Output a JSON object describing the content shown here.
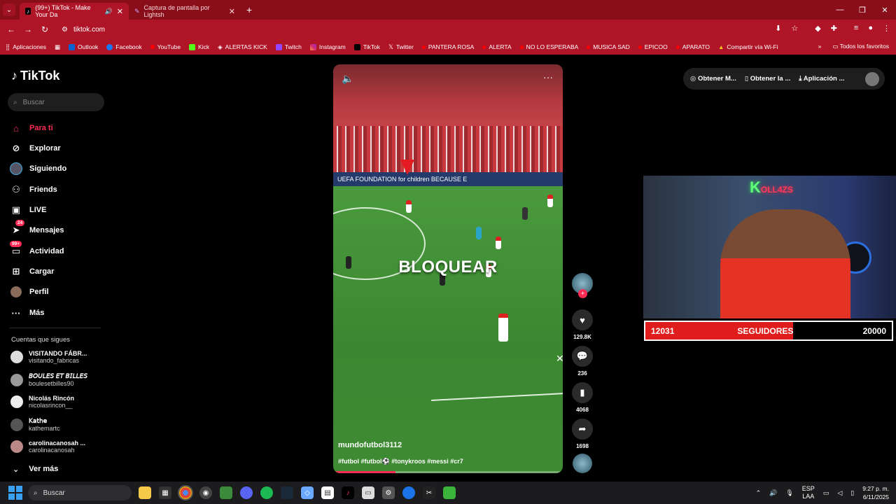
{
  "browser": {
    "tabs": [
      {
        "title": "(99+) TikTok - Make Your Da",
        "active": true
      },
      {
        "title": "Captura de pantalla por Lightsh",
        "active": false
      }
    ],
    "url": "tiktok.com",
    "bookmarks": [
      "Aplicaciones",
      "Outlook",
      "Facebook",
      "YouTube",
      "Kick",
      "ALERTAS KICK",
      "Twitch",
      "Instagram",
      "TikTok",
      "Twitter",
      "PANTERA ROSA",
      "ALERTA",
      "NO LO ESPERABA",
      "MUSICA SAD",
      "EPICOO",
      "APARATO",
      "Compartir vía Wi-Fi"
    ],
    "bookmarks_more": "»",
    "all_bookmarks": "Todos los favoritos",
    "accent": "#b01427"
  },
  "sidebar": {
    "logo": "TikTok",
    "search_placeholder": "Buscar",
    "nav": [
      {
        "label": "Para ti",
        "icon": "home-icon",
        "active": true
      },
      {
        "label": "Explorar",
        "icon": "compass-icon"
      },
      {
        "label": "Siguiendo",
        "icon": "following-avatar-icon"
      },
      {
        "label": "Friends",
        "icon": "friends-icon"
      },
      {
        "label": "LIVE",
        "icon": "live-icon"
      },
      {
        "label": "Mensajes",
        "icon": "messages-icon",
        "badge": "24"
      },
      {
        "label": "Actividad",
        "icon": "activity-icon",
        "badge": "99+"
      },
      {
        "label": "Cargar",
        "icon": "upload-icon"
      },
      {
        "label": "Perfil",
        "icon": "profile-avatar-icon"
      },
      {
        "label": "Más",
        "icon": "more-icon"
      }
    ],
    "following_title": "Cuentas que sigues",
    "accounts": [
      {
        "name": "VISITANDO FÁBR...",
        "handle": "visitando_fabricas"
      },
      {
        "name": "𝘉𝘖𝘜𝘓𝘌𝘚 𝘌𝘛 𝘉𝘐𝘓𝘓𝘌𝘚",
        "handle": "boulesetbilles90"
      },
      {
        "name": "Nicolás Rincón",
        "handle": "nicolasrincon__"
      },
      {
        "name": "𝖪𝖺𝗍𝗁𝖾",
        "handle": "kathemartc"
      },
      {
        "name": "carolinacanosah ...",
        "handle": "carolinacanosah"
      }
    ],
    "see_more": "Ver más"
  },
  "video": {
    "overlay_text": "BLOQUEAR",
    "author": "mundofutbol3112",
    "tags": "#futbol #futbol⚽ #tonykroos #messi #cr7",
    "adboard": "UEFA FOUNDATION for children     BECAUSE E",
    "progress": 0.27
  },
  "actions": {
    "likes": "129.8K",
    "comments": "236",
    "saves": "4068",
    "shares": "1698"
  },
  "top_right": {
    "coins": "Obtener M...",
    "app": "Obtener la ...",
    "download": "Aplicación ..."
  },
  "stream_overlay": {
    "neon_sign": "K",
    "neon_sub": "OLL4ZS",
    "followers_current": "12031",
    "followers_label": "SEGUIDORES",
    "followers_goal": "20000",
    "progress_fraction": 0.6
  },
  "taskbar": {
    "search_placeholder": "Buscar",
    "lang": "ESP",
    "lang2": "LAA",
    "time": "9:27 p. m.",
    "date": "6/11/2025"
  }
}
